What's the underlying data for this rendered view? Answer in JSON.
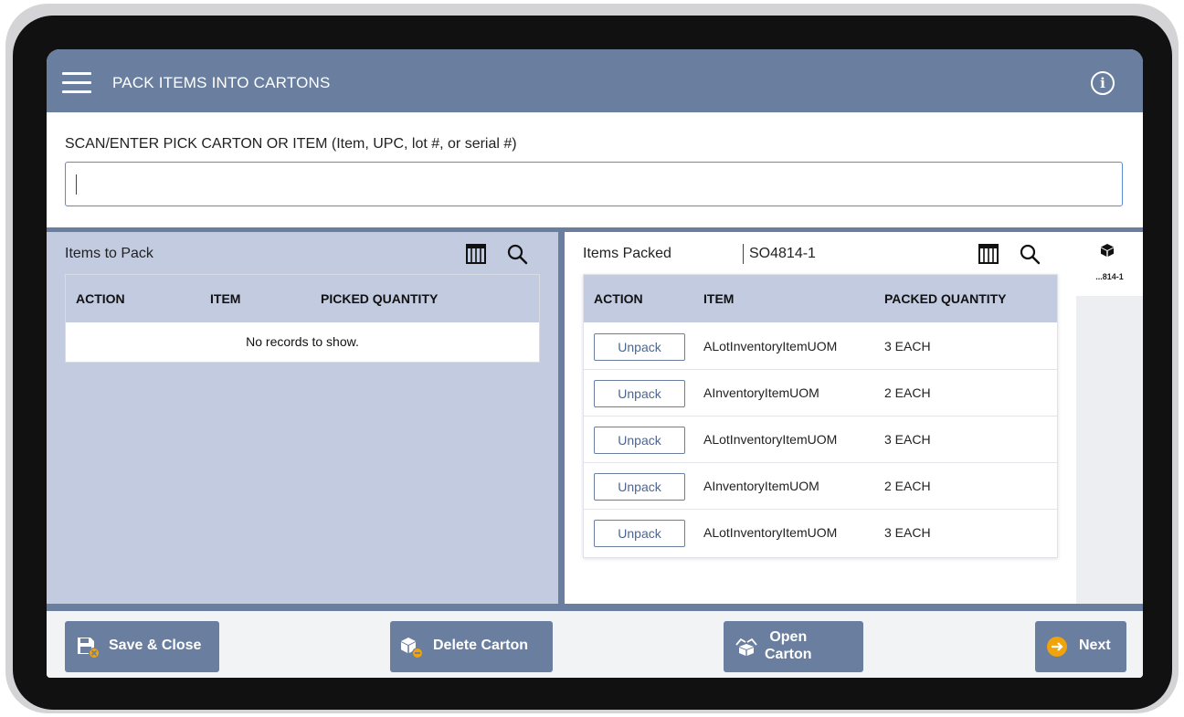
{
  "header": {
    "title": "PACK ITEMS INTO CARTONS",
    "info_icon": "info-circle-icon",
    "menu_icon": "hamburger-menu-icon"
  },
  "scan": {
    "label": "SCAN/ENTER PICK CARTON OR ITEM (Item, UPC, lot #, or serial #)",
    "value": "",
    "placeholder": ""
  },
  "items_to_pack": {
    "title": "Items to Pack",
    "columns": [
      "ACTION",
      "ITEM",
      "PICKED QUANTITY"
    ],
    "empty_message": "No records to show."
  },
  "items_packed": {
    "title": "Items Packed",
    "carton": "SO4814-1",
    "columns": [
      "ACTION",
      "ITEM",
      "PACKED QUANTITY"
    ],
    "rows": [
      {
        "action": "Unpack",
        "item": "ALotInventoryItemUOM",
        "quantity": "3 EACH"
      },
      {
        "action": "Unpack",
        "item": "AInventoryItemUOM",
        "quantity": "2 EACH"
      },
      {
        "action": "Unpack",
        "item": "ALotInventoryItemUOM",
        "quantity": "3 EACH"
      },
      {
        "action": "Unpack",
        "item": "AInventoryItemUOM",
        "quantity": "2 EACH"
      },
      {
        "action": "Unpack",
        "item": "ALotInventoryItemUOM",
        "quantity": "3 EACH"
      }
    ]
  },
  "carton_tab": {
    "label": "...814-1",
    "icon": "box-icon"
  },
  "footer": {
    "save_close": "Save & Close",
    "delete_carton": "Delete Carton",
    "open_carton_line1": "Open",
    "open_carton_line2": "Carton",
    "next": "Next"
  },
  "colors": {
    "header_bg": "#6a7f9f",
    "panel_bg": "#c3cbe0",
    "accent_orange": "#f0a30a",
    "input_border": "#5b8bd0"
  }
}
